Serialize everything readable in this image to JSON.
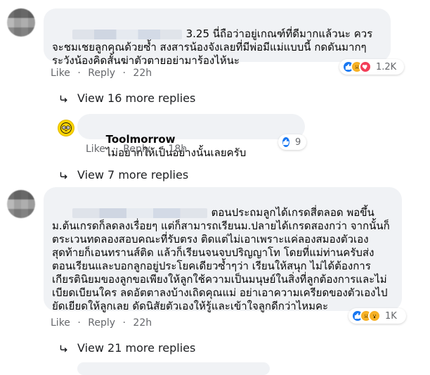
{
  "comments": [
    {
      "id": "c1",
      "text": "3.25 นี่ถือว่าอยู่เกณฑ์ที่ดีมากแล้วนะ ควรจะชมเชยลูกคุณด้วยซ้ำ สงสารน้องจังเลยที่มีพ่อมีแม่แบบนี้ กดดันมากๆระวังน้องคิดสั้นฆ่าตัวตายอย่ามาร้องไห้นะ",
      "like_label": "Like",
      "reply_label": "Reply",
      "time": "22h",
      "reaction_count": "1.2K",
      "view_more": "View 16 more replies"
    },
    {
      "id": "c2",
      "author": "Toolmorrow",
      "text": "ไม่อยากให้เป็นอย่างนั้นเลยครับ",
      "like_label": "Like",
      "reply_label": "Reply",
      "time": "18h",
      "reaction_count": "9"
    },
    {
      "id": "c3",
      "view_more": "View 7 more replies"
    },
    {
      "id": "c4",
      "text": "ตอนประถมลูกได้เกรดสี่ตลอด พอขึ้นม.ต้นเกรดก็ลดลงเรื่อยๆ แต่ก็สามารถเรียนม.ปลายได้เกรดสองกว่า จากนั้นก็ตระเวนทดลองสอบคณะที่รับตรง ติดแต่ไม่เอาเพราะแค่ลองสมองตัวเอง สุดท้ายก็เอนทรานส์ติด แล้วก็เรียนจนจบปริญญาโท โดยที่แม่ท่านครับส่งตอนเรียนและบอกลูกอยู่ประโยคเดียวซ้ำๆว่า เรียนให้สนุก ไม่ได้ต้องการเกียรตินิยมของลูกขอเพียงให้ลูกใช้ความเป็นมนุษย์ในสิ่งที่ลูกต้องการและไม่เบียดเบียนใคร ลดอัตตาลงบ้างเถิดคุณแม่ อย่าเอาความเครียดของตัวเองไปยัดเยียดให้ลูกเลย ดัดนิสัยตัวเองให้รู้และเข้าใจลูกดีกว่าไหมคะ",
      "like_label": "Like",
      "reply_label": "Reply",
      "time": "22h",
      "reaction_count": "1K",
      "view_more": "View 21 more replies"
    }
  ],
  "icons": {
    "reply_arrow": "reply-arrow-icon",
    "like": "like-reaction-icon",
    "sad": "sad-reaction-icon",
    "love": "love-reaction-icon",
    "wow": "wow-reaction-icon",
    "logo": "toolmorrow-logo-icon"
  },
  "colors": {
    "bubble": "#f0f2f5",
    "meta": "#65676b",
    "like_blue": "#1877f2",
    "love_red": "#f33e58",
    "sad_yellow": "#f7b125"
  }
}
